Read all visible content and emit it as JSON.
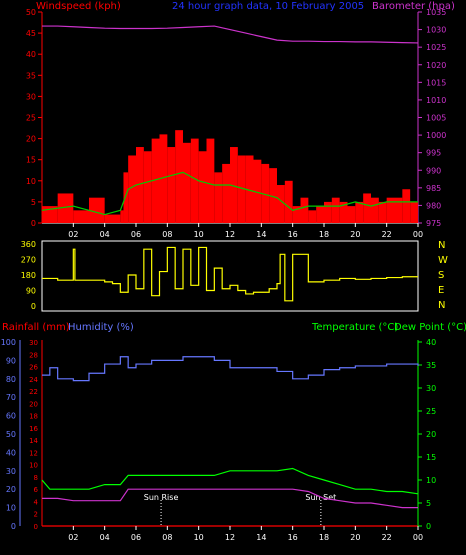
{
  "header": {
    "title": "24 hour graph data, 10 February 2005",
    "left_label": "Windspeed (kph)",
    "right_label": "Barometer (hpa)"
  },
  "colors": {
    "background": "#000000",
    "wind_gust": "#ff0000",
    "wind_avg": "#00cc00",
    "wind_min": "#ffffff",
    "barometer": "#cc33cc",
    "wind_direction": "#ffff00",
    "humidity": "#6677ff",
    "rainfall": "#ff0000",
    "temperature": "#00ff00",
    "dew_point": "#cc33cc",
    "axis_wind": "#ff0000",
    "axis_baro": "#cc33cc",
    "axis_dir": "#ffff00",
    "axis_humidity": "#6677ff",
    "axis_temperature": "#00ff00"
  },
  "x_ticks": [
    "02",
    "04",
    "06",
    "08",
    "10",
    "12",
    "14",
    "16",
    "18",
    "20",
    "22",
    "00"
  ],
  "compass": [
    "N",
    "W",
    "S",
    "E",
    "N"
  ],
  "chart_data": [
    {
      "type": "bar",
      "name": "wind",
      "ylim": [
        0,
        50
      ],
      "yticks": [
        0,
        5,
        10,
        15,
        20,
        25,
        30,
        35,
        40,
        45,
        50
      ],
      "y2lim": [
        975,
        1035
      ],
      "y2ticks": [
        975,
        980,
        985,
        990,
        995,
        1000,
        1005,
        1010,
        1015,
        1020,
        1025,
        1030,
        1035
      ],
      "series": [
        {
          "name": "Windspeed (kph)",
          "role": "gust",
          "x": [
            0,
            1,
            2,
            3,
            4,
            5,
            5.2,
            5.5,
            6,
            6.5,
            7,
            7.5,
            8,
            8.5,
            9,
            9.5,
            10,
            10.5,
            11,
            11.5,
            12,
            12.5,
            13,
            13.5,
            14,
            14.5,
            15,
            15.5,
            16,
            16.5,
            17,
            17.5,
            18,
            18.5,
            19,
            19.5,
            20,
            20.5,
            21,
            21.5,
            22,
            22.5,
            23,
            23.5
          ],
          "values": [
            4,
            7,
            3,
            6,
            2,
            3,
            12,
            16,
            18,
            17,
            20,
            21,
            18,
            22,
            19,
            20,
            17,
            20,
            12,
            14,
            18,
            16,
            16,
            15,
            14,
            13,
            9,
            10,
            4,
            6,
            3,
            4,
            5,
            6,
            5,
            4,
            5,
            7,
            6,
            5,
            6,
            6,
            8,
            5
          ]
        },
        {
          "name": "average",
          "role": "avg",
          "x": [
            0,
            2,
            4,
            5,
            5.5,
            6,
            7,
            8,
            9,
            10,
            11,
            12,
            13,
            14,
            15,
            16,
            17,
            18,
            19,
            20,
            21,
            22,
            23,
            24
          ],
          "values": [
            3,
            4,
            2,
            3,
            8,
            9,
            10,
            11,
            12,
            10,
            9,
            9,
            8,
            7,
            6,
            3,
            4,
            4,
            4,
            5,
            4,
            5,
            5,
            5
          ]
        },
        {
          "name": "Barometer (hpa)",
          "role": "baro",
          "x": [
            0,
            1,
            2,
            3,
            4,
            5,
            6,
            7,
            8,
            9,
            10,
            11,
            12,
            13,
            14,
            15,
            16,
            17,
            18,
            19,
            20,
            21,
            22,
            23,
            24
          ],
          "values": [
            1031,
            1031,
            1030.8,
            1030.6,
            1030.4,
            1030.3,
            1030.3,
            1030.3,
            1030.4,
            1030.6,
            1030.8,
            1031,
            1030,
            1029,
            1028,
            1027,
            1026.7,
            1026.7,
            1026.6,
            1026.6,
            1026.5,
            1026.5,
            1026.4,
            1026.3,
            1026.2
          ]
        }
      ]
    },
    {
      "type": "line",
      "name": "wind_direction",
      "ylim": [
        0,
        360
      ],
      "yticks": [
        0,
        90,
        180,
        270,
        360
      ],
      "series": [
        {
          "name": "direction",
          "x": [
            0,
            1,
            1.9,
            2,
            2.1,
            3,
            4,
            4.5,
            5,
            5.5,
            6,
            6.5,
            7,
            7.5,
            8,
            8.5,
            9,
            9.5,
            10,
            10.5,
            11,
            11.5,
            12,
            12.5,
            13,
            13.5,
            14,
            14.5,
            15,
            15.2,
            15.5,
            16,
            16.5,
            17,
            18,
            19,
            20,
            21,
            22,
            23,
            24
          ],
          "values": [
            160,
            150,
            150,
            330,
            150,
            150,
            140,
            130,
            80,
            180,
            100,
            330,
            60,
            200,
            340,
            100,
            330,
            120,
            340,
            90,
            220,
            100,
            120,
            90,
            70,
            80,
            80,
            100,
            130,
            300,
            30,
            300,
            300,
            140,
            150,
            160,
            155,
            160,
            165,
            170,
            170
          ]
        }
      ]
    },
    {
      "type": "line",
      "name": "temperature_humidity",
      "ylim": [
        0,
        40
      ],
      "yticks": [
        0,
        5,
        10,
        15,
        20,
        25,
        30,
        35,
        40
      ],
      "y_humidity_lim": [
        0,
        100
      ],
      "y_humidity_ticks": [
        0,
        10,
        20,
        30,
        40,
        50,
        60,
        70,
        80,
        90,
        100
      ],
      "y_rain_lim": [
        0,
        30
      ],
      "y_rain_ticks": [
        0,
        2,
        4,
        6,
        8,
        10,
        12,
        14,
        16,
        18,
        20,
        22,
        24,
        26,
        28,
        30
      ],
      "annotations": [
        {
          "label": "Sun Rise",
          "x": 7.6
        },
        {
          "label": "Sun Set",
          "x": 17.8
        }
      ],
      "series": [
        {
          "name": "Humidity (%)",
          "role": "humidity",
          "x": [
            0,
            0.5,
            1,
            2,
            3,
            4,
            5,
            5.5,
            6,
            7,
            8,
            9,
            10,
            11,
            12,
            13,
            14,
            15,
            16,
            17,
            18,
            19,
            20,
            21,
            22,
            23,
            24
          ],
          "values": [
            82,
            86,
            80,
            79,
            83,
            88,
            92,
            86,
            88,
            90,
            90,
            92,
            92,
            90,
            86,
            86,
            86,
            84,
            80,
            82,
            85,
            86,
            87,
            87,
            88,
            88,
            87
          ]
        },
        {
          "name": "Temperature (°C)",
          "role": "temp",
          "x": [
            0,
            0.5,
            1,
            2,
            3,
            4,
            5,
            5.5,
            6,
            7,
            8,
            9,
            10,
            11,
            12,
            13,
            14,
            15,
            16,
            17,
            18,
            19,
            20,
            21,
            22,
            23,
            24
          ],
          "values": [
            10,
            8,
            8,
            8,
            8,
            9,
            9,
            11,
            11,
            11,
            11,
            11,
            11,
            11,
            12,
            12,
            12,
            12,
            12.5,
            11,
            10,
            9,
            8,
            8,
            7.5,
            7.5,
            7
          ]
        },
        {
          "name": "Dew Point (°C)",
          "role": "dew",
          "x": [
            0,
            1,
            2,
            3,
            4,
            5,
            5.5,
            6,
            7,
            8,
            9,
            10,
            11,
            12,
            13,
            14,
            15,
            16,
            17,
            18,
            19,
            20,
            21,
            22,
            23,
            24
          ],
          "values": [
            6,
            6,
            5.5,
            5.5,
            5.5,
            5.5,
            8,
            8,
            8,
            8,
            8,
            8,
            8,
            8,
            8,
            8,
            8,
            8,
            7.5,
            6,
            5.5,
            5,
            5,
            4.5,
            4,
            4
          ]
        },
        {
          "name": "Rainfall (mm)",
          "role": "rain",
          "x": [
            0,
            24
          ],
          "values": [
            0,
            0
          ]
        }
      ]
    }
  ],
  "bottom_labels": {
    "left_rain": "Rainfall (mm)",
    "left_humidity": "Humidity (%)",
    "right_temp": "Temperature (°C)",
    "right_dew": "Dew Point (°C)"
  }
}
